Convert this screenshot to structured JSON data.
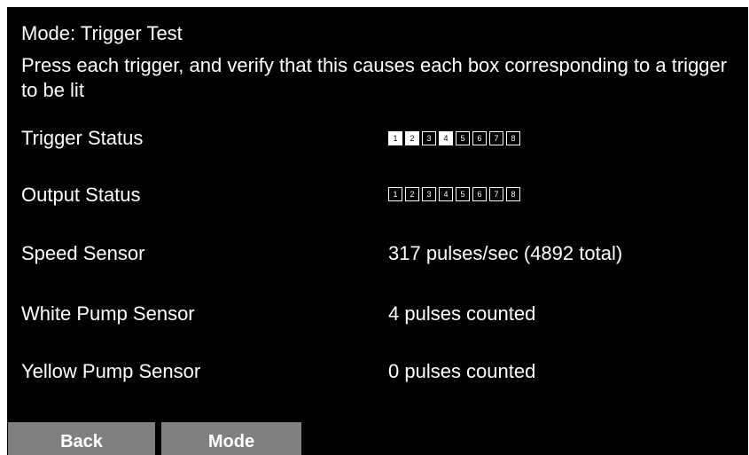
{
  "mode_line": "Mode: Trigger Test",
  "instructions": "Press each trigger, and verify that this causes each box corresponding to a trigger to be lit",
  "rows": {
    "trigger_status": {
      "label": "Trigger Status",
      "boxes": [
        {
          "n": "1",
          "lit": true
        },
        {
          "n": "2",
          "lit": true
        },
        {
          "n": "3",
          "lit": false
        },
        {
          "n": "4",
          "lit": true
        },
        {
          "n": "5",
          "lit": false
        },
        {
          "n": "6",
          "lit": false
        },
        {
          "n": "7",
          "lit": false
        },
        {
          "n": "8",
          "lit": false
        }
      ]
    },
    "output_status": {
      "label": "Output Status",
      "boxes": [
        {
          "n": "1",
          "lit": false
        },
        {
          "n": "2",
          "lit": false
        },
        {
          "n": "3",
          "lit": false
        },
        {
          "n": "4",
          "lit": false
        },
        {
          "n": "5",
          "lit": false
        },
        {
          "n": "6",
          "lit": false
        },
        {
          "n": "7",
          "lit": false
        },
        {
          "n": "8",
          "lit": false
        }
      ]
    },
    "speed_sensor": {
      "label": "Speed Sensor",
      "value": "317 pulses/sec (4892 total)"
    },
    "white_pump_sensor": {
      "label": "White Pump Sensor",
      "value": "4 pulses counted"
    },
    "yellow_pump_sensor": {
      "label": "Yellow Pump Sensor",
      "value": "0 pulses counted"
    }
  },
  "buttons": {
    "back": "Back",
    "mode": "Mode"
  },
  "colors": {
    "screen_background": "#000000",
    "text": "#ffffff",
    "lit_box": "#ffffff",
    "button_background": "#808080"
  }
}
